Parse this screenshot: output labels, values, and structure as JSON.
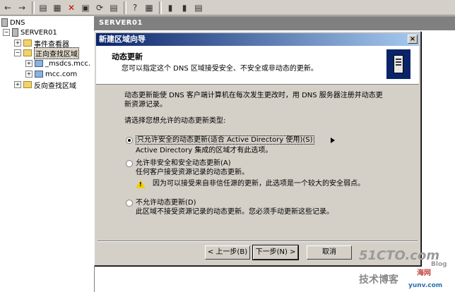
{
  "console": {
    "tree": {
      "root": "DNS",
      "server": "SERVER01",
      "event_viewer": "事件查看器",
      "forward_zones": "正向查找区域",
      "zone_msdcs": "_msdcs.mcc.",
      "zone_mcc": "mcc.com",
      "reverse_zones": "反向查找区域"
    },
    "right_header": "SERVER01"
  },
  "wizard": {
    "title": "新建区域向导",
    "close": "×",
    "header_title": "动态更新",
    "header_subtitle": "您可以指定这个 DNS 区域接受安全、不安全或非动态的更新。",
    "intro_line1": "动态更新能使 DNS 客户端计算机在每次发生更改时，用 DNS 服务器注册并动态更",
    "intro_line2": "新资源记录。",
    "choose_prompt": "请选择您想允许的动态更新类型:",
    "options": [
      {
        "label": "只允许安全的动态更新(适合 Active Directory 使用)(S)",
        "desc": "Active Directory 集成的区域才有此选项。",
        "selected": true
      },
      {
        "label": "允许非安全和安全动态更新(A)",
        "desc": "任何客户接受资源记录的动态更新。",
        "warning": "因为可以接受来自非信任源的更新，此选项是一个较大的安全弱点。",
        "selected": false
      },
      {
        "label": "不允许动态更新(D)",
        "desc": "此区域不接受资源记录的动态更新。您必须手动更新这些记录。",
        "selected": false
      }
    ],
    "buttons": {
      "back": "< 上一步(B)",
      "next": "下一步(N) >",
      "cancel": "取消"
    }
  },
  "watermarks": {
    "site_51cto": "51CTO.com",
    "blog": "Blog",
    "tech_blog": "技术博客",
    "haohai": "海网",
    "yunv": "yunv.com"
  },
  "colors": {
    "titlebar_start": "#0a246a",
    "titlebar_end": "#a6caf0",
    "dialog_face": "#d4d0c8",
    "warning_yellow": "#f0d000"
  }
}
